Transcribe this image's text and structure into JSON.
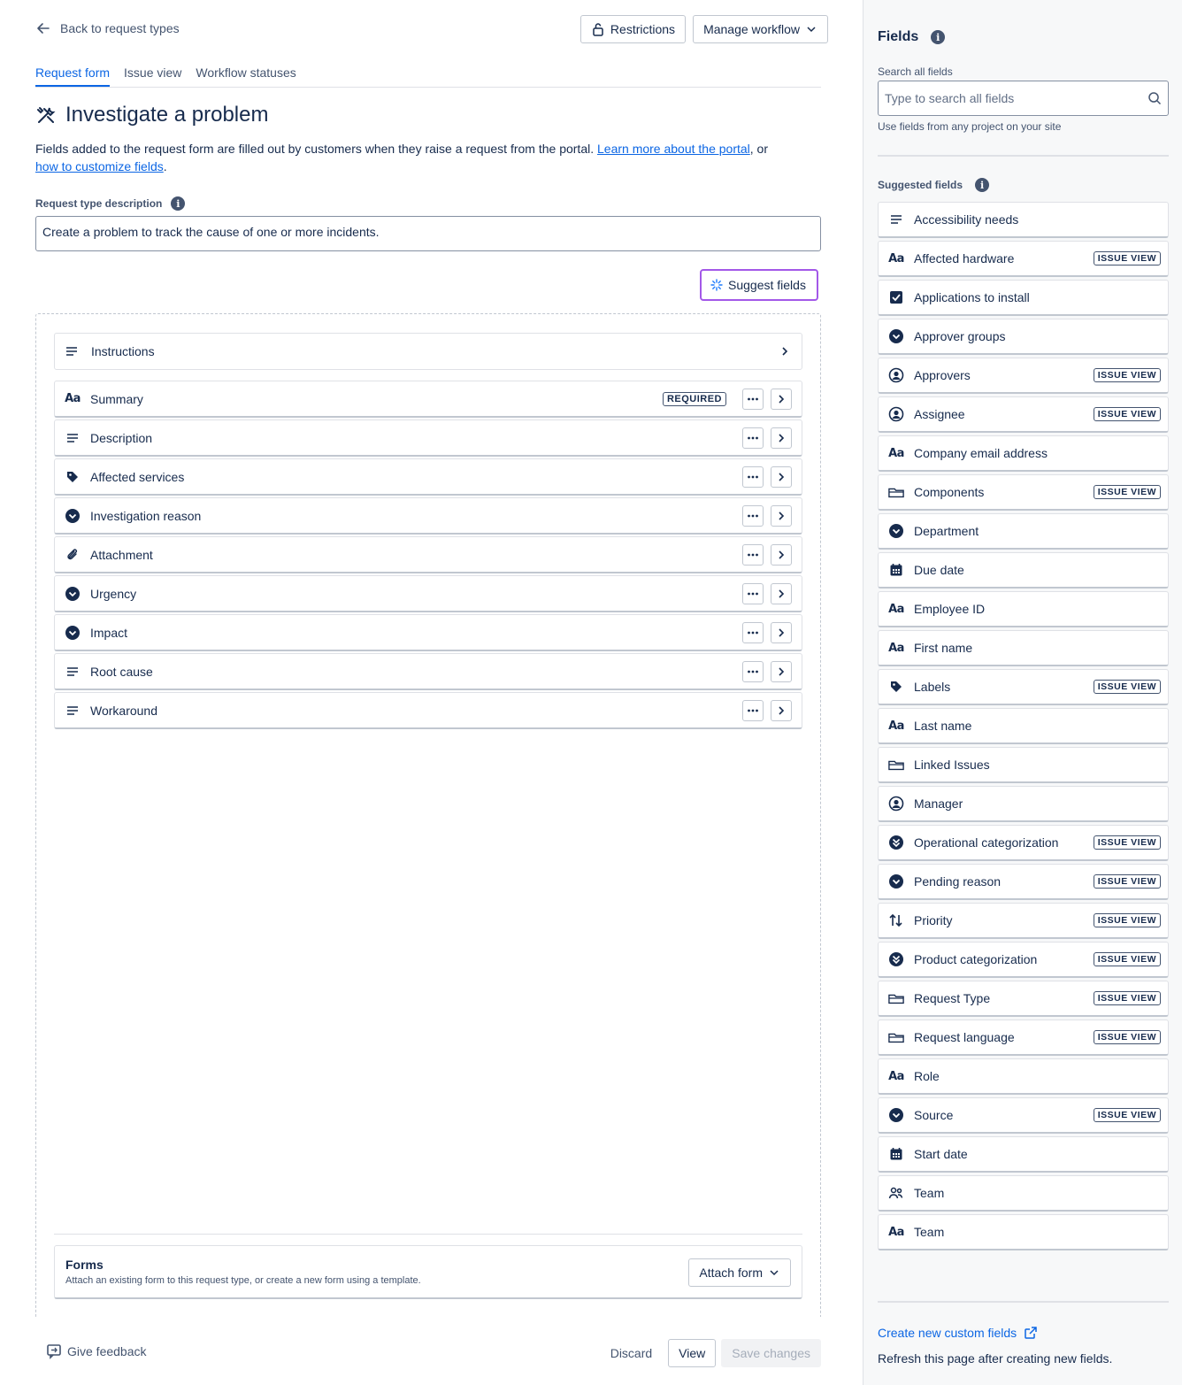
{
  "header": {
    "back_label": "Back to request types",
    "restrictions_label": "Restrictions",
    "manage_workflow_label": "Manage workflow"
  },
  "tabs": [
    {
      "label": "Request form",
      "active": true
    },
    {
      "label": "Issue view",
      "active": false
    },
    {
      "label": "Workflow statuses",
      "active": false
    }
  ],
  "page": {
    "title": "Investigate a problem",
    "intro_text": "Fields added to the request form are filled out by customers when they raise a request from the portal. ",
    "intro_link1": "Learn more about the portal",
    "intro_mid": ", or",
    "intro_link2": "how to customize fields",
    "intro_end": ".",
    "description_label": "Request type description",
    "description_value": "Create a problem to track the cause of one or more incidents.",
    "suggest_label": "Suggest fields"
  },
  "form": {
    "instructions_label": "Instructions",
    "required_lozenge": "REQUIRED",
    "fields": [
      {
        "label": "Summary",
        "icon": "text-icon",
        "required": true
      },
      {
        "label": "Description",
        "icon": "paragraph-icon"
      },
      {
        "label": "Affected services",
        "icon": "tag-icon"
      },
      {
        "label": "Investigation reason",
        "icon": "select-icon"
      },
      {
        "label": "Attachment",
        "icon": "paperclip-icon"
      },
      {
        "label": "Urgency",
        "icon": "select-icon"
      },
      {
        "label": "Impact",
        "icon": "select-icon"
      },
      {
        "label": "Root cause",
        "icon": "paragraph-icon"
      },
      {
        "label": "Workaround",
        "icon": "paragraph-icon"
      }
    ]
  },
  "forms_section": {
    "title": "Forms",
    "subtitle": "Attach an existing form to this request type, or create a new form using a template.",
    "attach_label": "Attach form"
  },
  "footer": {
    "feedback_label": "Give feedback",
    "discard_label": "Discard",
    "view_label": "View",
    "save_label": "Save changes"
  },
  "sidebar": {
    "title": "Fields",
    "search_label": "Search all fields",
    "search_placeholder": "Type to search all fields",
    "search_help": "Use fields from any project on your site",
    "suggested_label": "Suggested fields",
    "issue_view_lozenge": "ISSUE VIEW",
    "fields": [
      {
        "label": "Accessibility needs",
        "icon": "paragraph-icon",
        "issue_view": false
      },
      {
        "label": "Affected hardware",
        "icon": "text-icon",
        "issue_view": true
      },
      {
        "label": "Applications to install",
        "icon": "checkbox-icon",
        "issue_view": false
      },
      {
        "label": "Approver groups",
        "icon": "select-icon",
        "issue_view": false
      },
      {
        "label": "Approvers",
        "icon": "person-icon",
        "issue_view": true
      },
      {
        "label": "Assignee",
        "icon": "person-icon",
        "issue_view": true
      },
      {
        "label": "Company email address",
        "icon": "text-icon",
        "issue_view": false
      },
      {
        "label": "Components",
        "icon": "component-icon",
        "issue_view": true
      },
      {
        "label": "Department",
        "icon": "select-icon",
        "issue_view": false
      },
      {
        "label": "Due date",
        "icon": "calendar-icon",
        "issue_view": false
      },
      {
        "label": "Employee ID",
        "icon": "text-icon",
        "issue_view": false
      },
      {
        "label": "First name",
        "icon": "text-icon",
        "issue_view": false
      },
      {
        "label": "Labels",
        "icon": "tag-icon",
        "issue_view": true
      },
      {
        "label": "Last name",
        "icon": "text-icon",
        "issue_view": false
      },
      {
        "label": "Linked Issues",
        "icon": "component-icon",
        "issue_view": false
      },
      {
        "label": "Manager",
        "icon": "person-icon",
        "issue_view": false
      },
      {
        "label": "Operational categorization",
        "icon": "cascade-icon",
        "issue_view": true
      },
      {
        "label": "Pending reason",
        "icon": "select-icon",
        "issue_view": true
      },
      {
        "label": "Priority",
        "icon": "priority-icon",
        "issue_view": true
      },
      {
        "label": "Product categorization",
        "icon": "cascade-icon",
        "issue_view": true
      },
      {
        "label": "Request Type",
        "icon": "component-icon",
        "issue_view": true
      },
      {
        "label": "Request language",
        "icon": "component-icon",
        "issue_view": true
      },
      {
        "label": "Role",
        "icon": "text-icon",
        "issue_view": false
      },
      {
        "label": "Source",
        "icon": "select-icon",
        "issue_view": true
      },
      {
        "label": "Start date",
        "icon": "calendar-icon",
        "issue_view": false
      },
      {
        "label": "Team",
        "icon": "team-icon",
        "issue_view": false
      },
      {
        "label": "Team",
        "icon": "text-icon",
        "issue_view": false
      }
    ],
    "create_link": "Create new custom fields",
    "refresh_note": "Refresh this page after creating new fields."
  }
}
